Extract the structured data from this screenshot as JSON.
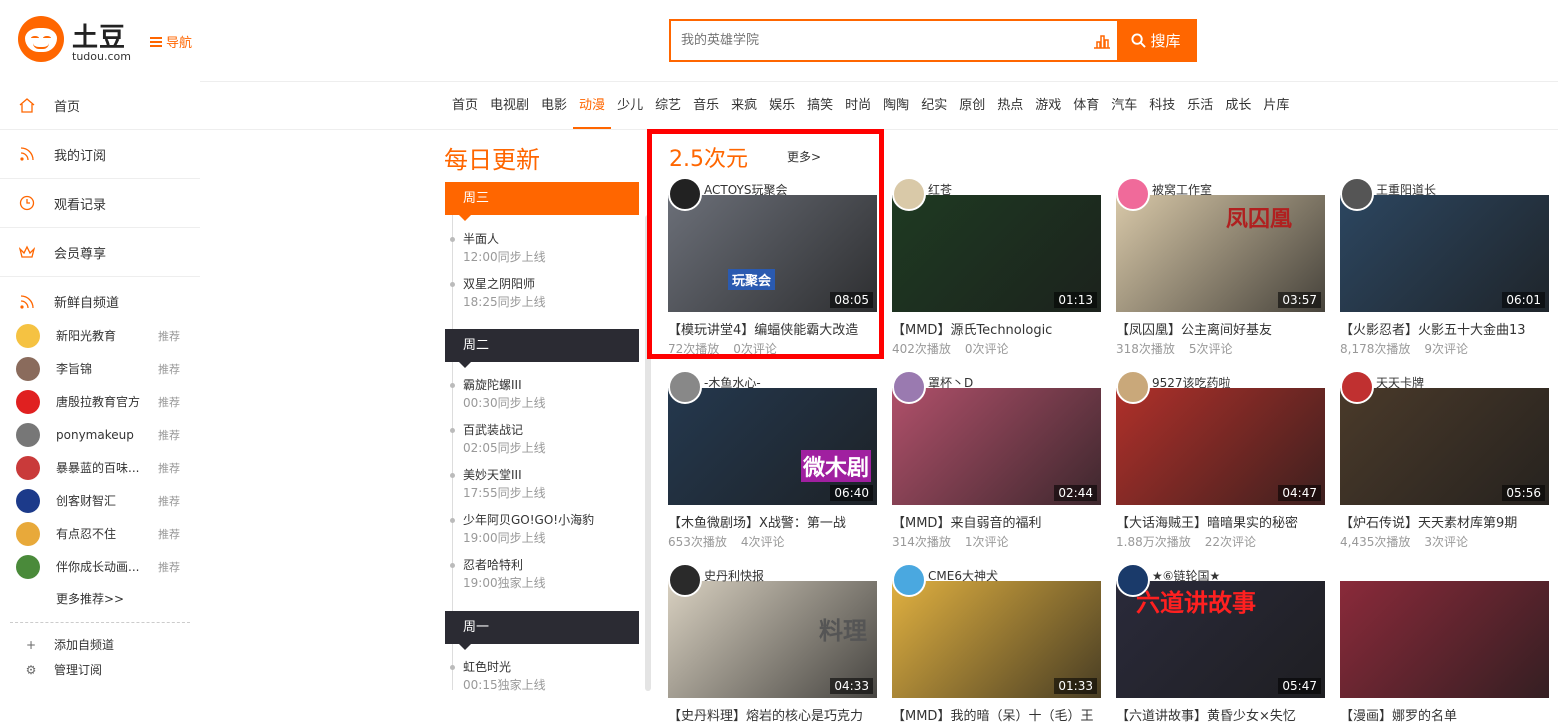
{
  "brand": {
    "name": "土豆",
    "sub": "tudou.com"
  },
  "header": {
    "nav_label": "导航",
    "search_placeholder": "我的英雄学院",
    "search_button": "搜库"
  },
  "sidebar": {
    "main": [
      {
        "label": "首页",
        "icon": "home-icon"
      },
      {
        "label": "我的订阅",
        "icon": "rss-icon"
      },
      {
        "label": "观看记录",
        "icon": "clock-icon"
      },
      {
        "label": "会员尊享",
        "icon": "crown-icon"
      },
      {
        "label": "新鲜自频道",
        "icon": "rss-icon"
      }
    ],
    "channels": [
      {
        "name": "新阳光教育",
        "tag": "推荐",
        "color": "#f5c242"
      },
      {
        "name": "李旨锦",
        "tag": "推荐",
        "color": "#8a6b5c"
      },
      {
        "name": "唐殷拉教育官方",
        "tag": "推荐",
        "color": "#e02020"
      },
      {
        "name": "ponymakeup",
        "tag": "推荐",
        "color": "#777777"
      },
      {
        "name": "暴暴蓝的百味...",
        "tag": "推荐",
        "color": "#c93a3a"
      },
      {
        "name": "创客财智汇",
        "tag": "推荐",
        "color": "#1c3a8a"
      },
      {
        "name": "有点忍不住",
        "tag": "推荐",
        "color": "#e8a93a"
      },
      {
        "name": "伴你成长动画...",
        "tag": "推荐",
        "color": "#4a8a3a"
      }
    ],
    "more": "更多推荐>>",
    "add": "添加自频道",
    "manage": "管理订阅"
  },
  "topnav": [
    "首页",
    "电视剧",
    "电影",
    "动漫",
    "少儿",
    "综艺",
    "音乐",
    "来疯",
    "娱乐",
    "搞笑",
    "时尚",
    "陶陶",
    "纪实",
    "原创",
    "热点",
    "游戏",
    "体育",
    "汽车",
    "科技",
    "乐活",
    "成长",
    "片库"
  ],
  "topnav_active": "动漫",
  "daily": {
    "title": "每日更新",
    "days": [
      {
        "label": "周三",
        "items": [
          {
            "name": "半面人",
            "time": "12:00同步上线"
          },
          {
            "name": "双星之阴阳师",
            "time": "18:25同步上线"
          }
        ]
      },
      {
        "label": "周二",
        "items": [
          {
            "name": "霸旋陀螺III",
            "time": "00:30同步上线"
          },
          {
            "name": "百武装战记",
            "time": "02:05同步上线"
          },
          {
            "name": "美妙天堂III",
            "time": "17:55同步上线"
          },
          {
            "name": "少年阿贝GO!GO!小海豹",
            "time": "19:00同步上线"
          },
          {
            "name": "忍者哈特利",
            "time": "19:00独家上线"
          }
        ]
      },
      {
        "label": "周一",
        "items": [
          {
            "name": "虹色时光",
            "time": "00:15独家上线"
          }
        ]
      }
    ]
  },
  "section": {
    "title": "2.5次元",
    "more": "更多>"
  },
  "videos": [
    {
      "uploader": "ACTOYS玩聚会",
      "duration": "08:05",
      "title": "【模玩讲堂4】编蝠侠能霸大改造",
      "plays": "72次播放",
      "comments": "0次评论",
      "bg": "#6b6f78",
      "av": "#222222",
      "overlay": "玩聚会"
    },
    {
      "uploader": "红苍",
      "duration": "01:13",
      "title": "【MMD】源氏Technologic",
      "plays": "402次播放",
      "comments": "0次评论",
      "bg": "#1e3a22",
      "av": "#d9c9a8",
      "overlay": ""
    },
    {
      "uploader": "被窝工作室",
      "duration": "03:57",
      "title": "【凤囚凰】公主离间好基友",
      "plays": "318次播放",
      "comments": "5次评论",
      "bg": "#d8c8a8",
      "av": "#f06a9a",
      "overlay": "凤囚凰"
    },
    {
      "uploader": "王重阳道长",
      "duration": "06:01",
      "title": "【火影忍者】火影五十大金曲13",
      "plays": "8,178次播放",
      "comments": "9次评论",
      "bg": "#2c4660",
      "av": "#555555",
      "overlay": ""
    },
    {
      "uploader": "-木鱼水心-",
      "duration": "06:40",
      "title": "【木鱼微剧场】X战警：第一战",
      "plays": "653次播放",
      "comments": "4次评论",
      "bg": "#24384e",
      "av": "#888888",
      "overlay": "微木剧"
    },
    {
      "uploader": "罩杯丶D",
      "duration": "02:44",
      "title": "【MMD】来自弱音的福利",
      "plays": "314次播放",
      "comments": "1次评论",
      "bg": "#b0506a",
      "av": "#9a7ab0",
      "overlay": ""
    },
    {
      "uploader": "9527该吃药啦",
      "duration": "04:47",
      "title": "【大话海贼王】暗暗果实的秘密",
      "plays": "1.88万次播放",
      "comments": "22次评论",
      "bg": "#b0302a",
      "av": "#c9a87a",
      "overlay": ""
    },
    {
      "uploader": "天天卡牌",
      "duration": "05:56",
      "title": "【炉石传说】天天素材库第9期",
      "plays": "4,435次播放",
      "comments": "3次评论",
      "bg": "#4a3a2a",
      "av": "#c03030",
      "overlay": ""
    },
    {
      "uploader": "史丹利快报",
      "duration": "04:33",
      "title": "【史丹料理】熔岩的核心是巧克力",
      "plays": "",
      "comments": "",
      "bg": "#d8d0c0",
      "av": "#2a2a2a",
      "overlay": "料理"
    },
    {
      "uploader": "CME6大神犬",
      "duration": "01:33",
      "title": "【MMD】我的暗（呆）十（毛）王",
      "plays": "",
      "comments": "",
      "bg": "#e0b040",
      "av": "#4aa8e0",
      "overlay": ""
    },
    {
      "uploader": "★⑥链轮国★",
      "duration": "05:47",
      "title": "【六道讲故事】黄昏少女×失忆",
      "plays": "",
      "comments": "",
      "bg": "#2a2a3a",
      "av": "#1a3a6a",
      "overlay": "六道讲故事"
    },
    {
      "uploader": "",
      "duration": "",
      "title": "【漫画】娜罗的名单",
      "plays": "",
      "comments": "",
      "bg": "#8a2a3a",
      "av": "#ffffff",
      "overlay": ""
    }
  ],
  "colors": {
    "accent": "#ff6600",
    "highlight": "#ff0000",
    "dark_tab": "#2b2b33"
  }
}
